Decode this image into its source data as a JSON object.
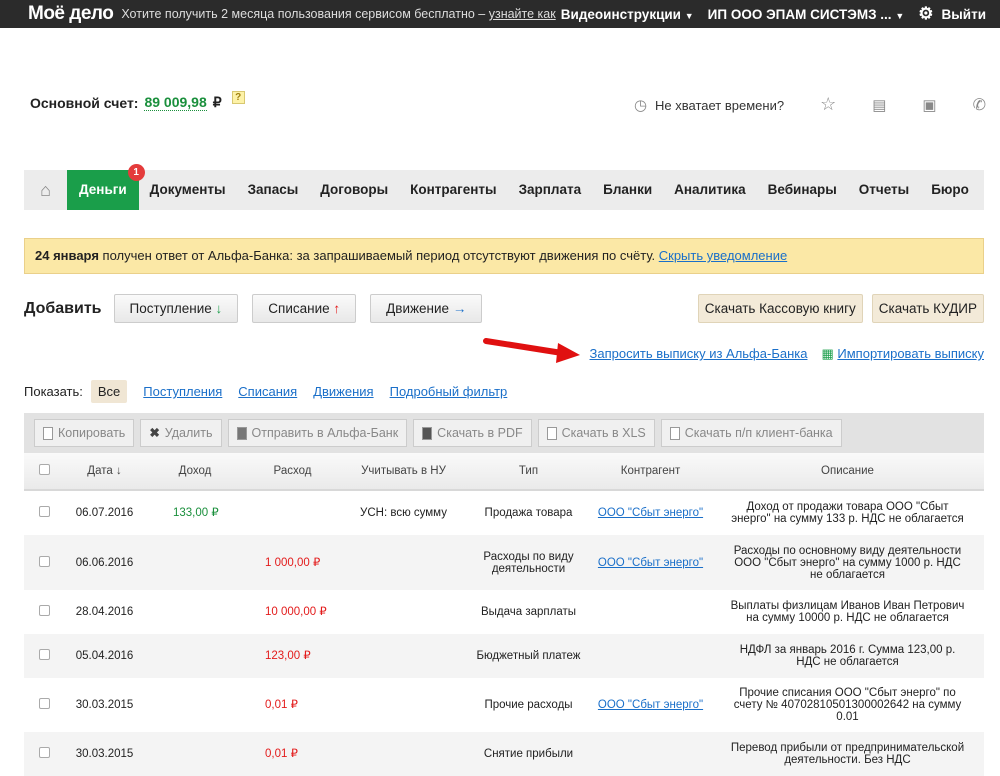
{
  "topbar": {
    "logo": "Моё дело",
    "promo": "Хотите получить 2 месяца пользования сервисом бесплатно –",
    "promo_link": "узнайте как",
    "video": "Видеоинструкции",
    "org": "ИП ООО ЭПАМ СИСТЭМЗ ...",
    "exit": "Выйти"
  },
  "account": {
    "label": "Основной счет:",
    "sum": "89 009,98",
    "currency": "₽",
    "help": "?"
  },
  "tools": {
    "no_time": "Не хватает времени?"
  },
  "nav": {
    "home": "⌂",
    "badge": "1",
    "items": [
      "Деньги",
      "Документы",
      "Запасы",
      "Договоры",
      "Контрагенты",
      "Зарплата",
      "Бланки",
      "Аналитика",
      "Вебинары",
      "Отчеты",
      "Бюро"
    ]
  },
  "notice": {
    "date": "24 января",
    "text": " получен ответ от Альфа-Банка: за запрашиваемый период отсутствуют движения по счёту. ",
    "link": "Скрыть уведомление"
  },
  "add": {
    "label": "Добавить",
    "income": "Поступление",
    "income_arrow": "↓",
    "expense": "Списание",
    "expense_arrow": "↑",
    "move": "Движение",
    "move_arrow": "→"
  },
  "downloads": {
    "cash": "Скачать Кассовую книгу",
    "kudir": "Скачать КУДИР"
  },
  "links": {
    "request": "Запросить выписку из Альфа-Банка",
    "import": "Импортировать выписку"
  },
  "filter": {
    "label": "Показать:",
    "items": [
      "Все",
      "Поступления",
      "Списания",
      "Движения",
      "Подробный фильтр"
    ]
  },
  "toolbar": [
    "Копировать",
    "Удалить",
    "Отправить в Альфа-Банк",
    "Скачать в PDF",
    "Скачать в XLS",
    "Скачать п/п клиент-банка"
  ],
  "table": {
    "headers": [
      "Дата ↓",
      "Доход",
      "Расход",
      "Учитывать в НУ",
      "Тип",
      "Контрагент",
      "Описание"
    ],
    "rows": [
      {
        "date": "06.07.2016",
        "income": "133,00 ₽",
        "expense": "",
        "nu": "УСН: всю сумму",
        "type": "Продажа товара",
        "contr": "ООО \"Сбыт энерго\"",
        "desc": "Доход от продажи товара ООО \"Сбыт энерго\" на сумму 133 р. НДС не облагается"
      },
      {
        "date": "06.06.2016",
        "income": "",
        "expense": "1 000,00 ₽",
        "nu": "",
        "type": "Расходы по виду деятельности",
        "contr": "ООО \"Сбыт энерго\"",
        "desc": "Расходы по основному виду деятельности ООО \"Сбыт энерго\" на сумму 1000 р. НДС не облагается"
      },
      {
        "date": "28.04.2016",
        "income": "",
        "expense": "10 000,00 ₽",
        "nu": "",
        "type": "Выдача зарплаты",
        "contr": "",
        "desc": "Выплаты физлицам Иванов Иван Петрович на сумму 10000 р. НДС не облагается"
      },
      {
        "date": "05.04.2016",
        "income": "",
        "expense": "123,00 ₽",
        "nu": "",
        "type": "Бюджетный платеж",
        "contr": "",
        "desc": "НДФЛ за январь 2016 г. Сумма 123,00 р. НДС не облагается"
      },
      {
        "date": "30.03.2015",
        "income": "",
        "expense": "0,01 ₽",
        "nu": "",
        "type": "Прочие расходы",
        "contr": "ООО \"Сбыт энерго\"",
        "desc": "Прочие списания ООО \"Сбыт энерго\" по счету № 40702810501300002642 на сумму 0.01"
      },
      {
        "date": "30.03.2015",
        "income": "",
        "expense": "0,01 ₽",
        "nu": "",
        "type": "Снятие прибыли",
        "contr": "",
        "desc": "Перевод прибыли от предпринимательской деятельности. Без НДС"
      }
    ]
  }
}
